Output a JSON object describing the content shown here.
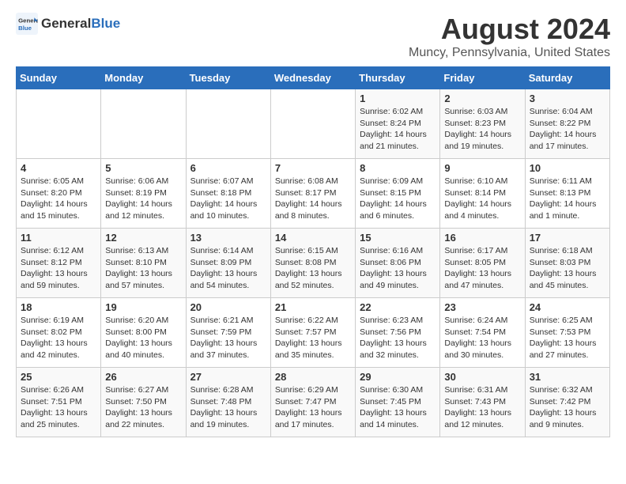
{
  "header": {
    "logo_general": "General",
    "logo_blue": "Blue",
    "title": "August 2024",
    "subtitle": "Muncy, Pennsylvania, United States"
  },
  "weekdays": [
    "Sunday",
    "Monday",
    "Tuesday",
    "Wednesday",
    "Thursday",
    "Friday",
    "Saturday"
  ],
  "weeks": [
    [
      {
        "day": "",
        "info": ""
      },
      {
        "day": "",
        "info": ""
      },
      {
        "day": "",
        "info": ""
      },
      {
        "day": "",
        "info": ""
      },
      {
        "day": "1",
        "info": "Sunrise: 6:02 AM\nSunset: 8:24 PM\nDaylight: 14 hours\nand 21 minutes."
      },
      {
        "day": "2",
        "info": "Sunrise: 6:03 AM\nSunset: 8:23 PM\nDaylight: 14 hours\nand 19 minutes."
      },
      {
        "day": "3",
        "info": "Sunrise: 6:04 AM\nSunset: 8:22 PM\nDaylight: 14 hours\nand 17 minutes."
      }
    ],
    [
      {
        "day": "4",
        "info": "Sunrise: 6:05 AM\nSunset: 8:20 PM\nDaylight: 14 hours\nand 15 minutes."
      },
      {
        "day": "5",
        "info": "Sunrise: 6:06 AM\nSunset: 8:19 PM\nDaylight: 14 hours\nand 12 minutes."
      },
      {
        "day": "6",
        "info": "Sunrise: 6:07 AM\nSunset: 8:18 PM\nDaylight: 14 hours\nand 10 minutes."
      },
      {
        "day": "7",
        "info": "Sunrise: 6:08 AM\nSunset: 8:17 PM\nDaylight: 14 hours\nand 8 minutes."
      },
      {
        "day": "8",
        "info": "Sunrise: 6:09 AM\nSunset: 8:15 PM\nDaylight: 14 hours\nand 6 minutes."
      },
      {
        "day": "9",
        "info": "Sunrise: 6:10 AM\nSunset: 8:14 PM\nDaylight: 14 hours\nand 4 minutes."
      },
      {
        "day": "10",
        "info": "Sunrise: 6:11 AM\nSunset: 8:13 PM\nDaylight: 14 hours\nand 1 minute."
      }
    ],
    [
      {
        "day": "11",
        "info": "Sunrise: 6:12 AM\nSunset: 8:12 PM\nDaylight: 13 hours\nand 59 minutes."
      },
      {
        "day": "12",
        "info": "Sunrise: 6:13 AM\nSunset: 8:10 PM\nDaylight: 13 hours\nand 57 minutes."
      },
      {
        "day": "13",
        "info": "Sunrise: 6:14 AM\nSunset: 8:09 PM\nDaylight: 13 hours\nand 54 minutes."
      },
      {
        "day": "14",
        "info": "Sunrise: 6:15 AM\nSunset: 8:08 PM\nDaylight: 13 hours\nand 52 minutes."
      },
      {
        "day": "15",
        "info": "Sunrise: 6:16 AM\nSunset: 8:06 PM\nDaylight: 13 hours\nand 49 minutes."
      },
      {
        "day": "16",
        "info": "Sunrise: 6:17 AM\nSunset: 8:05 PM\nDaylight: 13 hours\nand 47 minutes."
      },
      {
        "day": "17",
        "info": "Sunrise: 6:18 AM\nSunset: 8:03 PM\nDaylight: 13 hours\nand 45 minutes."
      }
    ],
    [
      {
        "day": "18",
        "info": "Sunrise: 6:19 AM\nSunset: 8:02 PM\nDaylight: 13 hours\nand 42 minutes."
      },
      {
        "day": "19",
        "info": "Sunrise: 6:20 AM\nSunset: 8:00 PM\nDaylight: 13 hours\nand 40 minutes."
      },
      {
        "day": "20",
        "info": "Sunrise: 6:21 AM\nSunset: 7:59 PM\nDaylight: 13 hours\nand 37 minutes."
      },
      {
        "day": "21",
        "info": "Sunrise: 6:22 AM\nSunset: 7:57 PM\nDaylight: 13 hours\nand 35 minutes."
      },
      {
        "day": "22",
        "info": "Sunrise: 6:23 AM\nSunset: 7:56 PM\nDaylight: 13 hours\nand 32 minutes."
      },
      {
        "day": "23",
        "info": "Sunrise: 6:24 AM\nSunset: 7:54 PM\nDaylight: 13 hours\nand 30 minutes."
      },
      {
        "day": "24",
        "info": "Sunrise: 6:25 AM\nSunset: 7:53 PM\nDaylight: 13 hours\nand 27 minutes."
      }
    ],
    [
      {
        "day": "25",
        "info": "Sunrise: 6:26 AM\nSunset: 7:51 PM\nDaylight: 13 hours\nand 25 minutes."
      },
      {
        "day": "26",
        "info": "Sunrise: 6:27 AM\nSunset: 7:50 PM\nDaylight: 13 hours\nand 22 minutes."
      },
      {
        "day": "27",
        "info": "Sunrise: 6:28 AM\nSunset: 7:48 PM\nDaylight: 13 hours\nand 19 minutes."
      },
      {
        "day": "28",
        "info": "Sunrise: 6:29 AM\nSunset: 7:47 PM\nDaylight: 13 hours\nand 17 minutes."
      },
      {
        "day": "29",
        "info": "Sunrise: 6:30 AM\nSunset: 7:45 PM\nDaylight: 13 hours\nand 14 minutes."
      },
      {
        "day": "30",
        "info": "Sunrise: 6:31 AM\nSunset: 7:43 PM\nDaylight: 13 hours\nand 12 minutes."
      },
      {
        "day": "31",
        "info": "Sunrise: 6:32 AM\nSunset: 7:42 PM\nDaylight: 13 hours\nand 9 minutes."
      }
    ]
  ]
}
